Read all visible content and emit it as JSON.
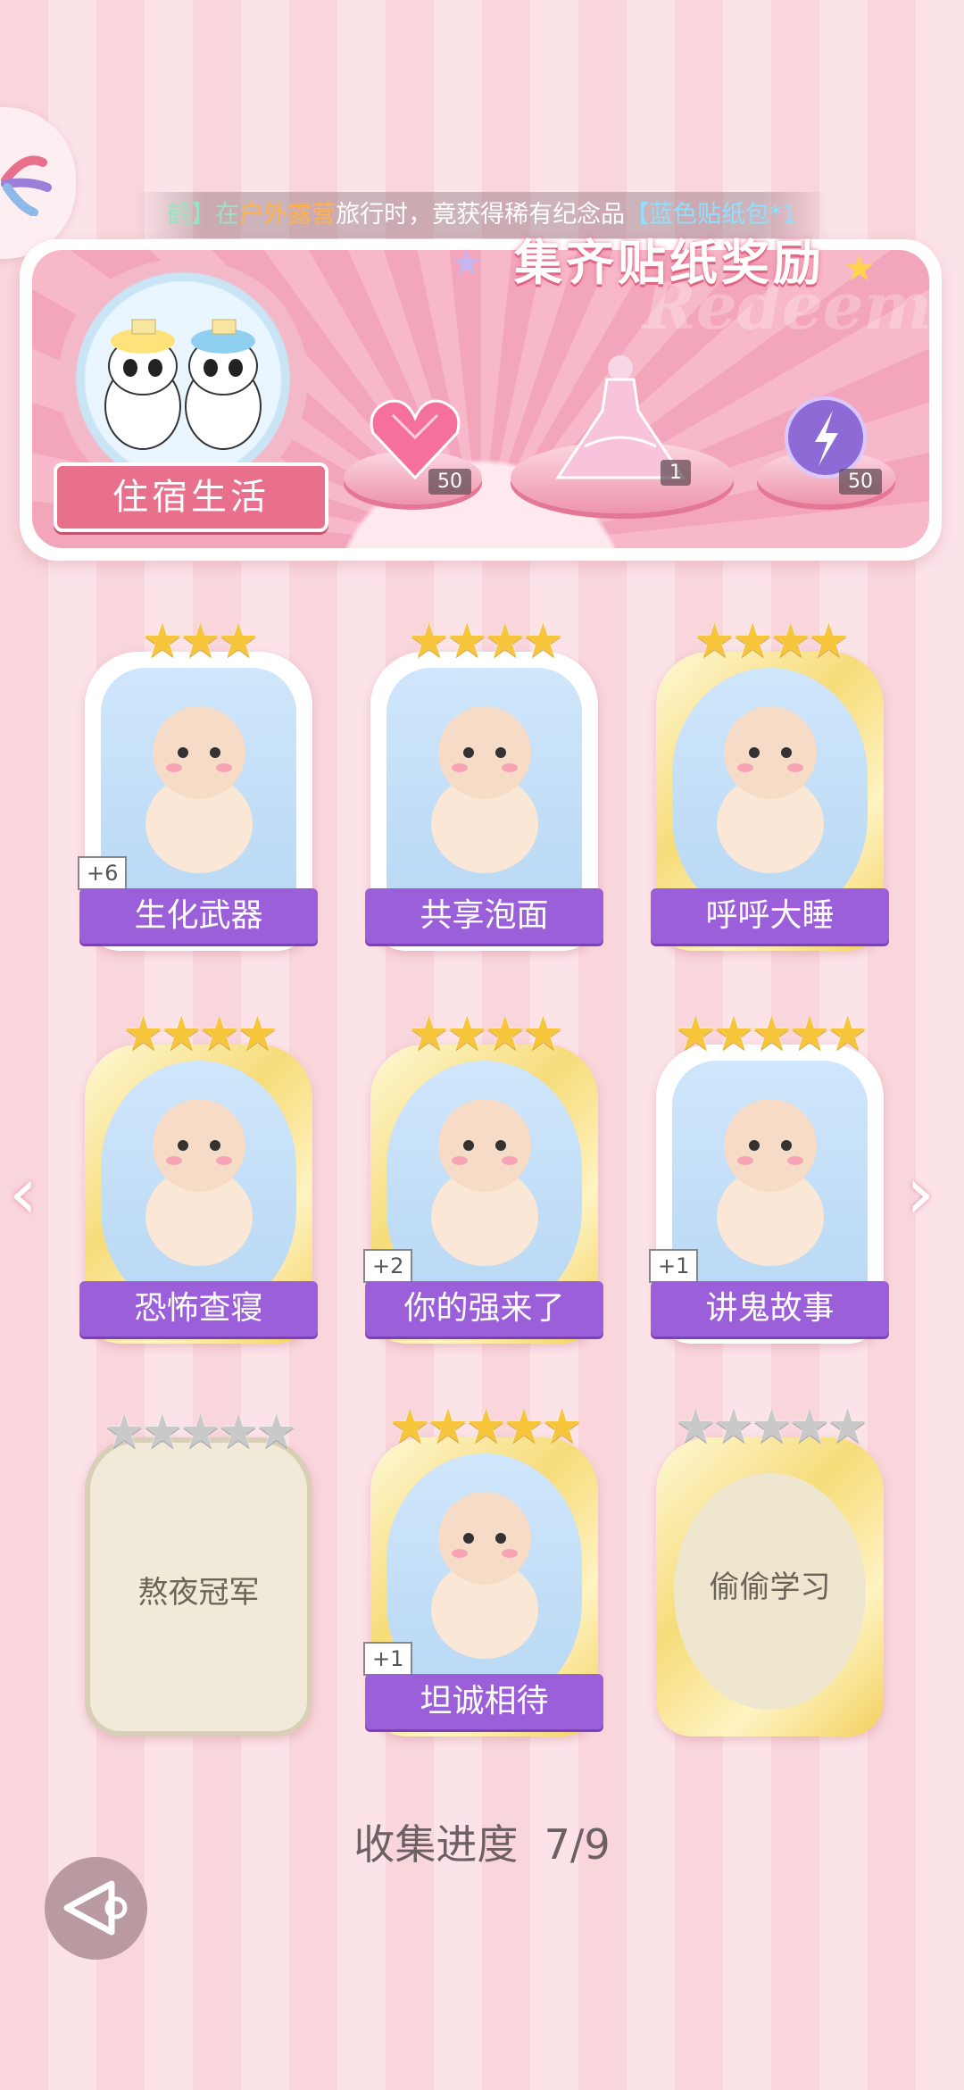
{
  "ticker": {
    "prefix": "鹤】在",
    "place": "户外露营",
    "mid": "旅行时，竟获得稀有纪念品",
    "item": "【蓝色贴纸包*1"
  },
  "banner": {
    "title": "集齐贴纸奖励",
    "watermark": "Redeem",
    "album_name": "住宿生活",
    "rewards": [
      {
        "icon": "heart-gem-icon",
        "count": "50"
      },
      {
        "icon": "dress-icon",
        "count": "1"
      },
      {
        "icon": "energy-orb-icon",
        "count": "50"
      }
    ]
  },
  "cards": [
    {
      "name": "生化武器",
      "stars": 3,
      "plus": "+6",
      "gold": false,
      "locked": false,
      "art": "capybara-pajama-icon"
    },
    {
      "name": "共享泡面",
      "stars": 4,
      "plus": "",
      "gold": false,
      "locked": false,
      "art": "bunny-noodles-icon"
    },
    {
      "name": "呼呼大睡",
      "stars": 4,
      "plus": "",
      "gold": true,
      "locked": false,
      "art": "sleeping-boy-icon"
    },
    {
      "name": "恐怖查寝",
      "stars": 4,
      "plus": "",
      "gold": true,
      "locked": false,
      "art": "dorm-auntie-icon"
    },
    {
      "name": "你的强来了",
      "stars": 4,
      "plus": "+2",
      "gold": true,
      "locked": false,
      "art": "cockroach-icon"
    },
    {
      "name": "讲鬼故事",
      "stars": 5,
      "plus": "+1",
      "gold": false,
      "locked": false,
      "art": "ghost-boy-icon"
    },
    {
      "name": "熬夜冠军",
      "stars": 5,
      "plus": "",
      "gold": false,
      "locked": true,
      "art": ""
    },
    {
      "name": "坦诚相待",
      "stars": 5,
      "plus": "+1",
      "gold": true,
      "locked": false,
      "art": "pandas-bath-icon"
    },
    {
      "name": "偷偷学习",
      "stars": 5,
      "plus": "",
      "gold": true,
      "locked": true,
      "art": ""
    }
  ],
  "progress": {
    "label": "收集进度",
    "value": "7/9"
  },
  "colors": {
    "accent_purple": "#9b5fd9",
    "accent_pink": "#e8708c",
    "star_gold": "#f7c53a"
  }
}
